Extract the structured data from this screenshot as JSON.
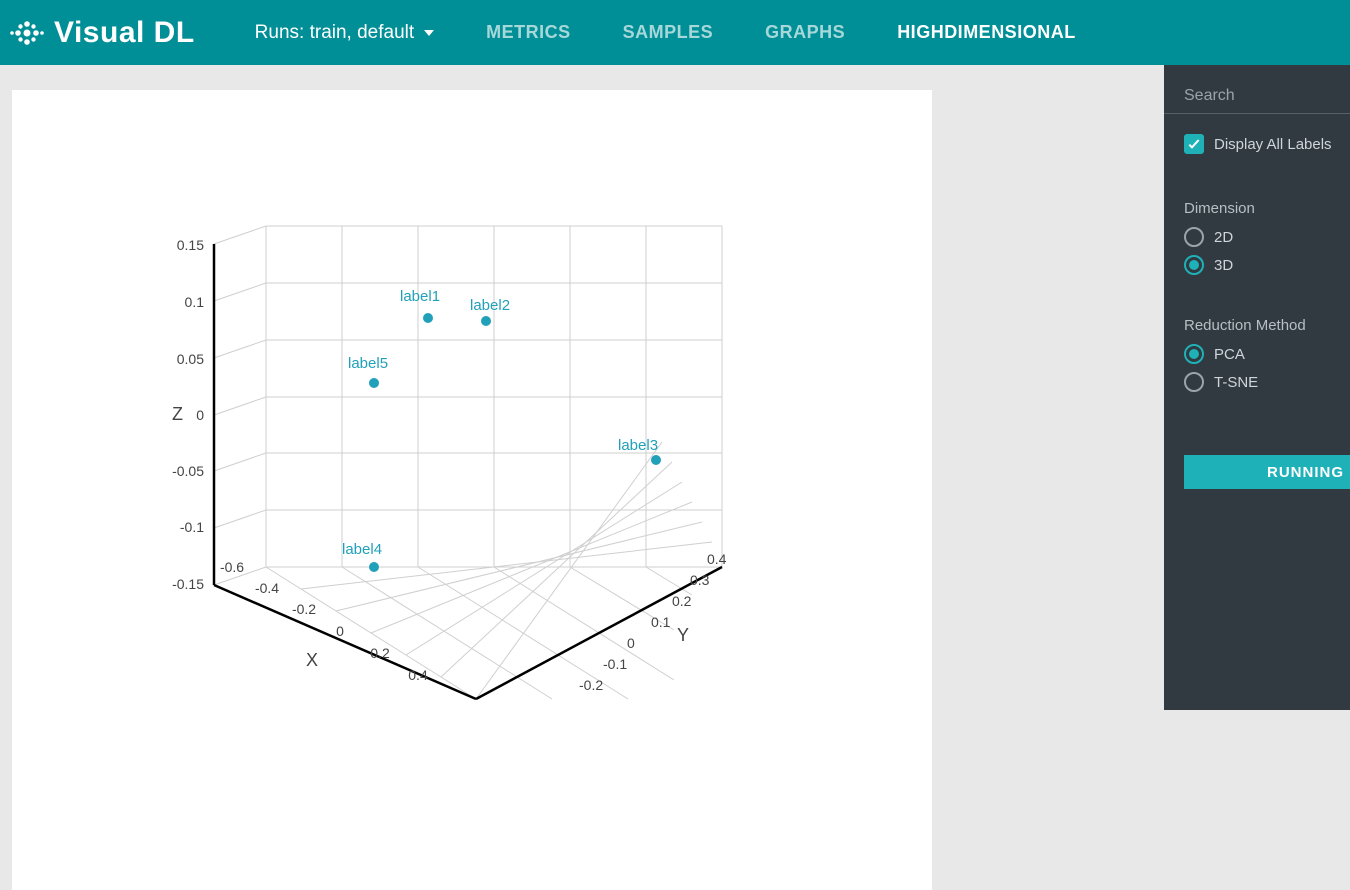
{
  "header": {
    "brand": "Visual DL",
    "runs_label": "Runs: train, default",
    "tabs": [
      "METRICS",
      "SAMPLES",
      "GRAPHS",
      "HIGHDIMENSIONAL"
    ],
    "active_tab": 3
  },
  "sidebar": {
    "search_placeholder": "Search",
    "display_all_labels_label": "Display All Labels",
    "display_all_labels_checked": true,
    "dimension_title": "Dimension",
    "dimension_options": [
      "2D",
      "3D"
    ],
    "dimension_selected": "3D",
    "reduction_title": "Reduction Method",
    "reduction_options": [
      "PCA",
      "T-SNE"
    ],
    "reduction_selected": "PCA",
    "run_button": "RUNNING"
  },
  "chart_data": {
    "type": "scatter3d",
    "title": "",
    "axes": {
      "x": {
        "label": "X",
        "ticks": [
          -0.6,
          -0.4,
          -0.2,
          0,
          0.2,
          0.4
        ],
        "range": [
          -0.6,
          0.6
        ]
      },
      "y": {
        "label": "Y",
        "ticks": [
          -0.2,
          -0.1,
          0,
          0.1,
          0.2,
          0.3,
          0.4
        ],
        "range": [
          -0.2,
          0.4
        ]
      },
      "z": {
        "label": "Z",
        "ticks": [
          -0.15,
          -0.1,
          -0.05,
          0,
          0.05,
          0.1,
          0.15
        ],
        "range": [
          -0.15,
          0.15
        ]
      }
    },
    "points": [
      {
        "label": "label1",
        "x": -0.05,
        "y": 0.3,
        "z": 0.11
      },
      {
        "label": "label2",
        "x": 0.05,
        "y": 0.2,
        "z": 0.1
      },
      {
        "label": "label3",
        "x": 0.35,
        "y": 0.2,
        "z": -0.02
      },
      {
        "label": "label4",
        "x": -0.1,
        "y": -0.15,
        "z": -0.13
      },
      {
        "label": "label5",
        "x": -0.2,
        "y": 0.1,
        "z": 0.06
      }
    ]
  }
}
